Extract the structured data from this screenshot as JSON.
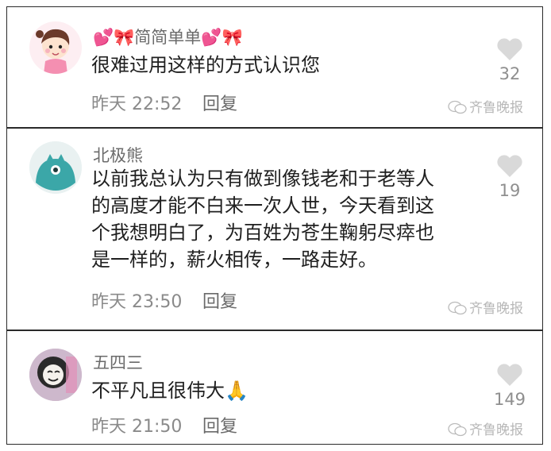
{
  "comments": [
    {
      "username": "💕🎀简简单单💕🎀",
      "text_lines": [
        "很难过用这样的方式认识您"
      ],
      "time": "昨天 22:52",
      "reply_label": "回复",
      "likes": "32",
      "watermark": "齐鲁晚报",
      "avatar_icon": "girl-avatar-icon"
    },
    {
      "username": "北极熊",
      "text_lines": [
        "以前我总认为只有做到像钱老和于老等人",
        "的高度才能不白来一次人世，今天看到这",
        "个我想明白了，为百姓为苍生鞠躬尽瘁也",
        "是一样的，薪火相传，一路走好。"
      ],
      "time": "昨天 23:50",
      "reply_label": "回复",
      "likes": "19",
      "watermark": "齐鲁晚报",
      "avatar_icon": "teal-monster-avatar-icon"
    },
    {
      "username": "五四三",
      "text_lines": [
        "不平凡且很伟大🙏"
      ],
      "time": "昨天 21:50",
      "reply_label": "回复",
      "likes": "149",
      "watermark": "齐鲁晚报",
      "avatar_icon": "meme-face-avatar-icon"
    }
  ],
  "colors": {
    "heart": "#d9d9d9",
    "text": "#1f1f1f",
    "meta": "#8a8a8a",
    "teal": "#3ba7a8"
  }
}
